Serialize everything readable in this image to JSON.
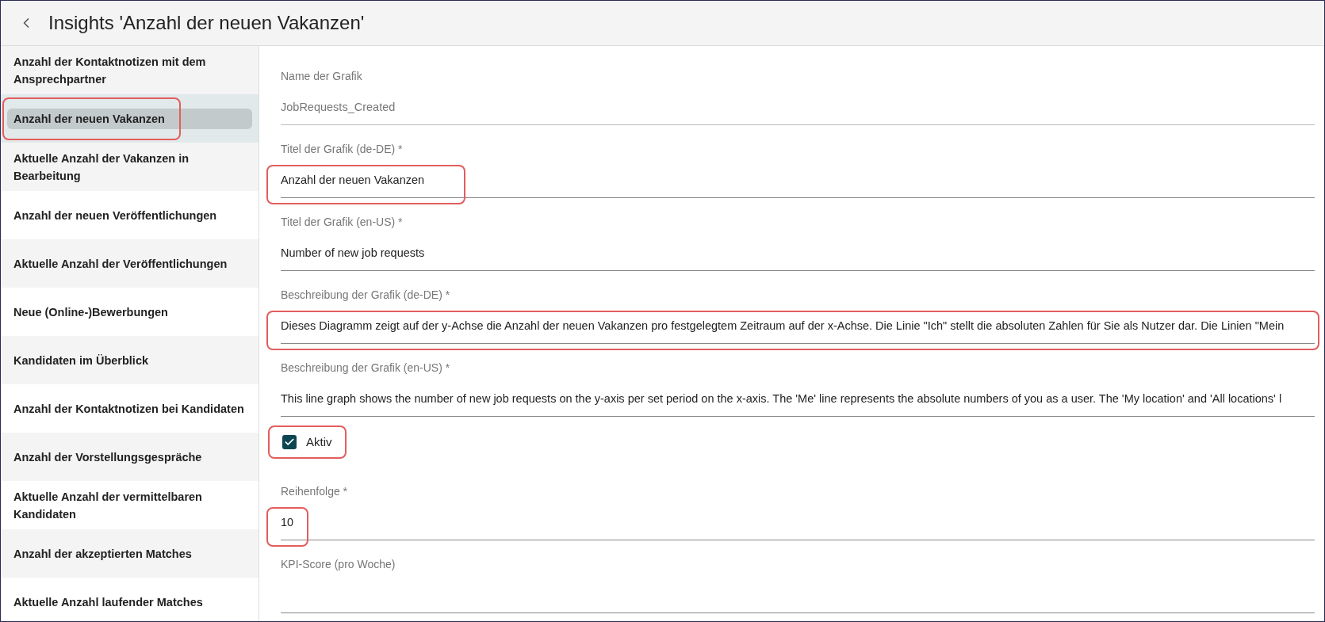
{
  "header": {
    "title": "Insights 'Anzahl der neuen Vakanzen'"
  },
  "sidebar": {
    "items": [
      {
        "label": "Anzahl der Kontaktnotizen mit dem Ansprechpartner",
        "selected": false,
        "highlighted": false
      },
      {
        "label": "Anzahl der neuen Vakanzen",
        "selected": true,
        "highlighted": true
      },
      {
        "label": "Aktuelle Anzahl der Vakanzen in Bearbeitung",
        "selected": false,
        "highlighted": false
      },
      {
        "label": "Anzahl der neuen Veröffentlichungen",
        "selected": false,
        "highlighted": false
      },
      {
        "label": "Aktuelle Anzahl der Veröffentlichungen",
        "selected": false,
        "highlighted": false
      },
      {
        "label": "Neue (Online-)Bewerbungen",
        "selected": false,
        "highlighted": false
      },
      {
        "label": "Kandidaten im Überblick",
        "selected": false,
        "highlighted": false
      },
      {
        "label": "Anzahl der Kontaktnotizen bei Kandidaten",
        "selected": false,
        "highlighted": false
      },
      {
        "label": "Anzahl der Vorstellungsgespräche",
        "selected": false,
        "highlighted": false
      },
      {
        "label": "Aktuelle Anzahl der vermittelbaren Kandidaten",
        "selected": false,
        "highlighted": false
      },
      {
        "label": "Anzahl der akzeptierten Matches",
        "selected": false,
        "highlighted": false
      },
      {
        "label": "Aktuelle Anzahl laufender Matches",
        "selected": false,
        "highlighted": false
      }
    ]
  },
  "form": {
    "fields": [
      {
        "kind": "text",
        "label": "Name der Grafik",
        "value": "JobRequests_Created",
        "disabled": true,
        "highlighted": false
      },
      {
        "kind": "text",
        "label": "Titel der Grafik (de-DE) *",
        "value": "Anzahl der neuen Vakanzen",
        "disabled": false,
        "highlighted": true
      },
      {
        "kind": "text",
        "label": "Titel der Grafik (en-US) *",
        "value": "Number of new job requests",
        "disabled": false,
        "highlighted": false
      },
      {
        "kind": "text",
        "label": "Beschreibung der Grafik (de-DE) *",
        "value": "Dieses Diagramm zeigt auf der y-Achse die Anzahl der neuen Vakanzen pro festgelegtem Zeitraum auf der x-Achse. Die Linie \"Ich\" stellt die absoluten Zahlen für Sie als Nutzer dar. Die Linien \"Mein",
        "disabled": false,
        "highlighted": true
      },
      {
        "kind": "text",
        "label": "Beschreibung der Grafik (en-US) *",
        "value": "This line graph shows the number of new job requests on the y-axis per set period on the x-axis. The 'Me' line represents the absolute numbers of you as a user. The 'My location' and 'All locations' l",
        "disabled": false,
        "highlighted": false
      },
      {
        "kind": "checkbox",
        "label": "Aktiv",
        "checked": true,
        "highlighted": true
      },
      {
        "kind": "text",
        "label": "Reihenfolge *",
        "value": "10",
        "disabled": false,
        "highlighted": true
      },
      {
        "kind": "text",
        "label": "KPI-Score (pro Woche)",
        "disabled": false,
        "highlighted": false
      }
    ]
  }
}
